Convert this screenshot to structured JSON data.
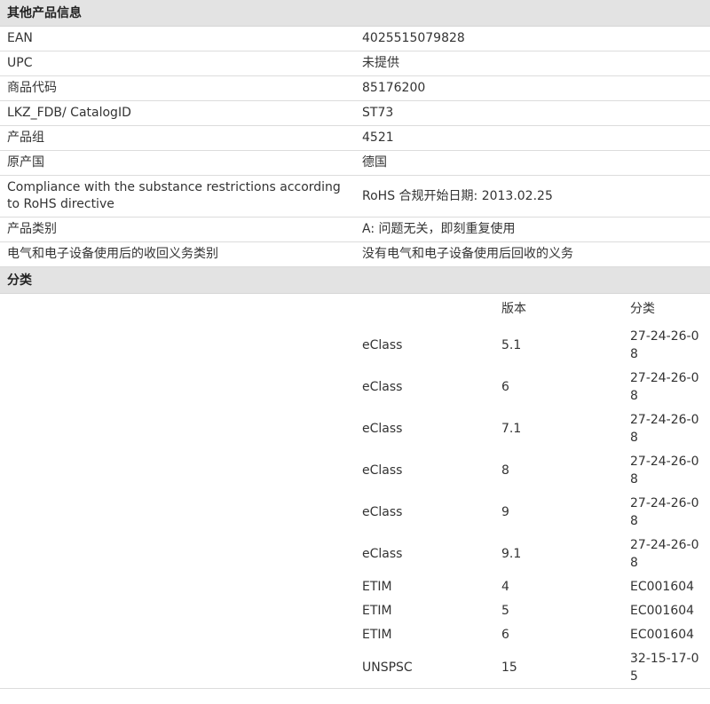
{
  "other_info": {
    "title": "其他产品信息",
    "rows": [
      {
        "label": "EAN",
        "value": "4025515079828"
      },
      {
        "label": "UPC",
        "value": "未提供"
      },
      {
        "label": "商品代码",
        "value": "85176200"
      },
      {
        "label": "LKZ_FDB/ CatalogID",
        "value": "ST73"
      },
      {
        "label": "产品组",
        "value": "4521"
      },
      {
        "label": "原产国",
        "value": "德国"
      },
      {
        "label": "Compliance with the substance restrictions according to RoHS directive",
        "value": "RoHS 合规开始日期: 2013.02.25"
      },
      {
        "label": "产品类别",
        "value": "A: 问题无关，即刻重复使用"
      },
      {
        "label": "电气和电子设备使用后的收回义务类别",
        "value": "没有电气和电子设备使用后回收的义务"
      }
    ]
  },
  "classification": {
    "title": "分类",
    "headers": {
      "system": "",
      "version": "版本",
      "class": "分类"
    },
    "rows": [
      {
        "system": "eClass",
        "version": "5.1",
        "class": "27-24-26-08"
      },
      {
        "system": "eClass",
        "version": "6",
        "class": "27-24-26-08"
      },
      {
        "system": "eClass",
        "version": "7.1",
        "class": "27-24-26-08"
      },
      {
        "system": "eClass",
        "version": "8",
        "class": "27-24-26-08"
      },
      {
        "system": "eClass",
        "version": "9",
        "class": "27-24-26-08"
      },
      {
        "system": "eClass",
        "version": "9.1",
        "class": "27-24-26-08"
      },
      {
        "system": "ETIM",
        "version": "4",
        "class": "EC001604"
      },
      {
        "system": "ETIM",
        "version": "5",
        "class": "EC001604"
      },
      {
        "system": "ETIM",
        "version": "6",
        "class": "EC001604"
      },
      {
        "system": "UNSPSC",
        "version": "15",
        "class": "32-15-17-05"
      }
    ]
  },
  "colors": {
    "header_bg": "#e3e3e3",
    "row_border": "#dcdcdc",
    "text": "#333333"
  }
}
